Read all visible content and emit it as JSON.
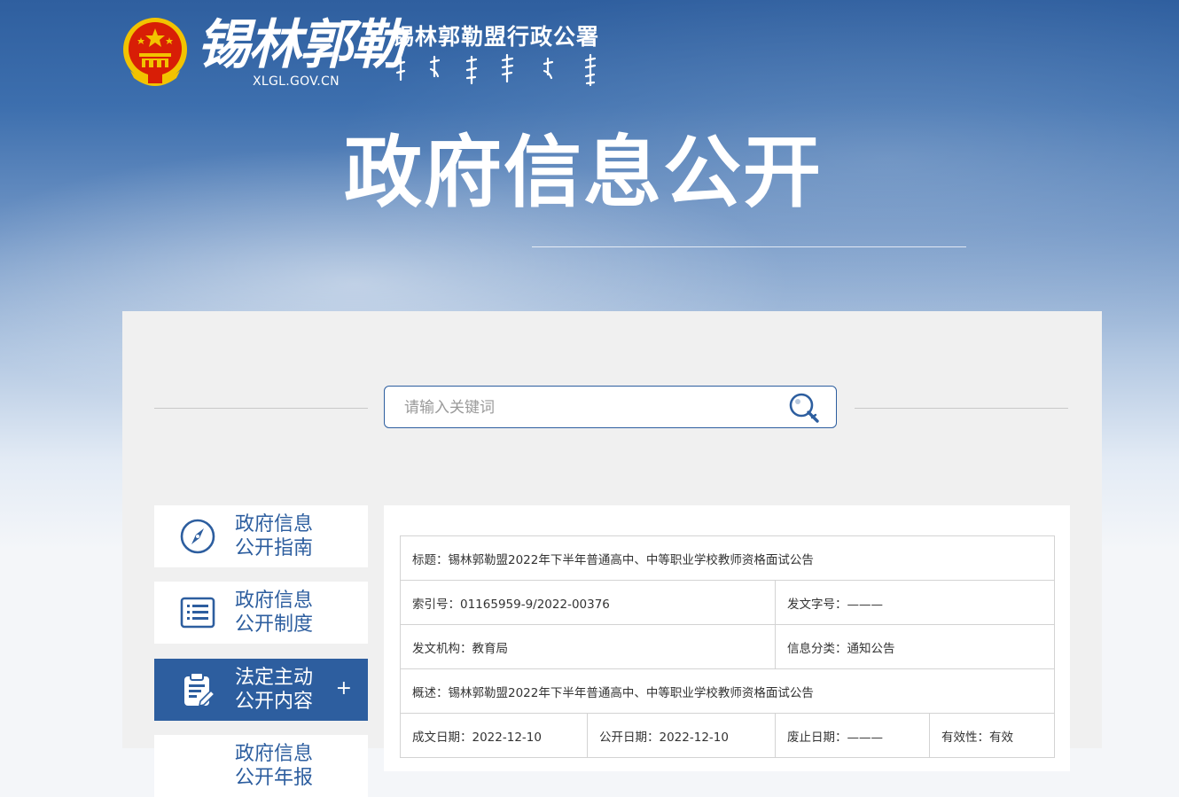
{
  "header": {
    "logo_script": "锡林郭勒",
    "logo_domain": "XLGL.GOV.CN",
    "site_name": "锡林郭勒盟行政公署",
    "page_title": "政府信息公开"
  },
  "search": {
    "placeholder": "请输入关键词"
  },
  "sidebar": {
    "items": [
      {
        "line1": "政府信息",
        "line2": "公开指南"
      },
      {
        "line1": "政府信息",
        "line2": "公开制度"
      },
      {
        "line1": "法定主动",
        "line2": "公开内容",
        "plus": "+"
      },
      {
        "line1": "政府信息",
        "line2": "公开年报"
      }
    ]
  },
  "document": {
    "title": "标题：锡林郭勒盟2022年下半年普通高中、中等职业学校教师资格面试公告",
    "index_no": "索引号：01165959-9/2022-00376",
    "doc_no": "发文字号：———",
    "issuer": "发文机构：教育局",
    "category": "信息分类：通知公告",
    "summary": "概述：锡林郭勒盟2022年下半年普通高中、中等职业学校教师资格面试公告",
    "created": "成文日期：2022-12-10",
    "published": "公开日期：2022-12-10",
    "abolished": "废止日期：———",
    "validity": "有效性：有效"
  },
  "colors": {
    "brand_blue": "#2d5e9f",
    "panel_bg": "#f0f0f0"
  }
}
